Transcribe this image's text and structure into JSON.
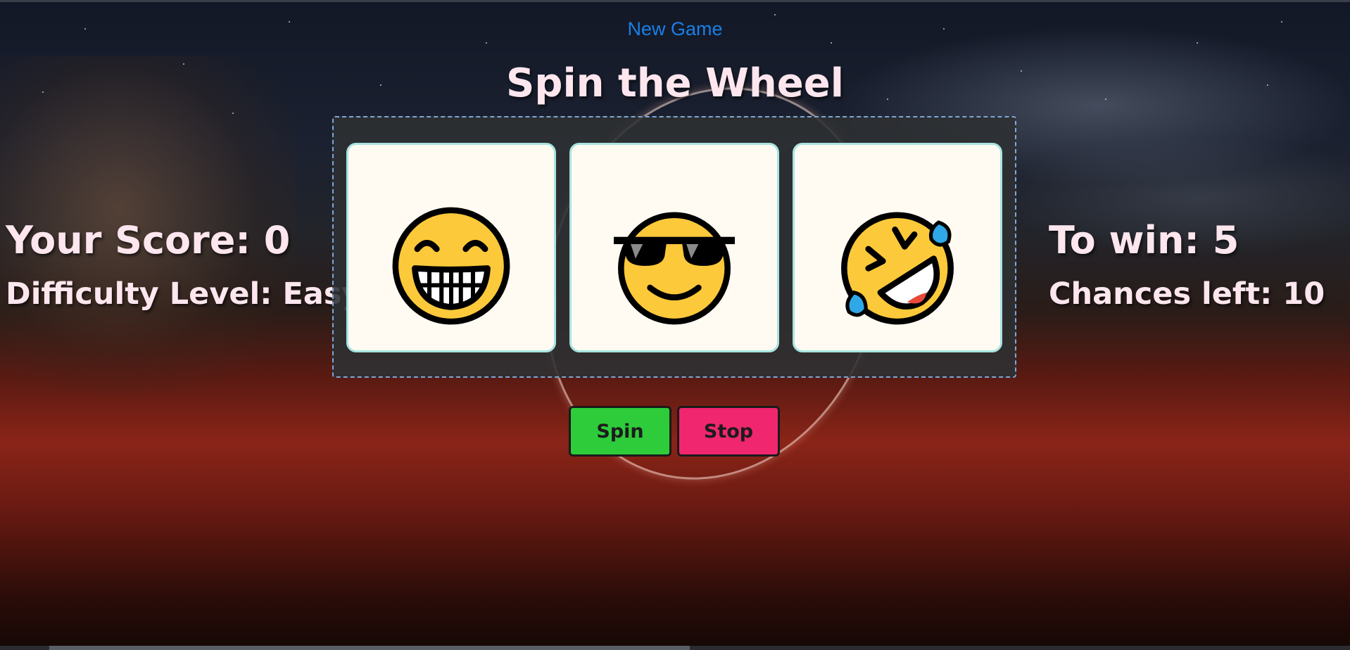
{
  "header": {
    "new_game_label": "New Game",
    "title": "Spin the Wheel"
  },
  "stats": {
    "score_label": "Your Score: 0",
    "difficulty_label": "Difficulty Level: Easy",
    "to_win_label": "To win: 5",
    "chances_label": "Chances left: 10"
  },
  "reels": [
    {
      "icon": "grinning-face-icon"
    },
    {
      "icon": "smiling-face-with-sunglasses-icon"
    },
    {
      "icon": "rolling-on-the-floor-laughing-icon"
    }
  ],
  "controls": {
    "spin_label": "Spin",
    "stop_label": "Stop"
  },
  "colors": {
    "new_game_link": "#1a7fe8",
    "spin_button": "#2ecc3a",
    "stop_button": "#f0266f",
    "reel_border": "#a8e4e0",
    "frame_border": "#7fa6d8"
  }
}
